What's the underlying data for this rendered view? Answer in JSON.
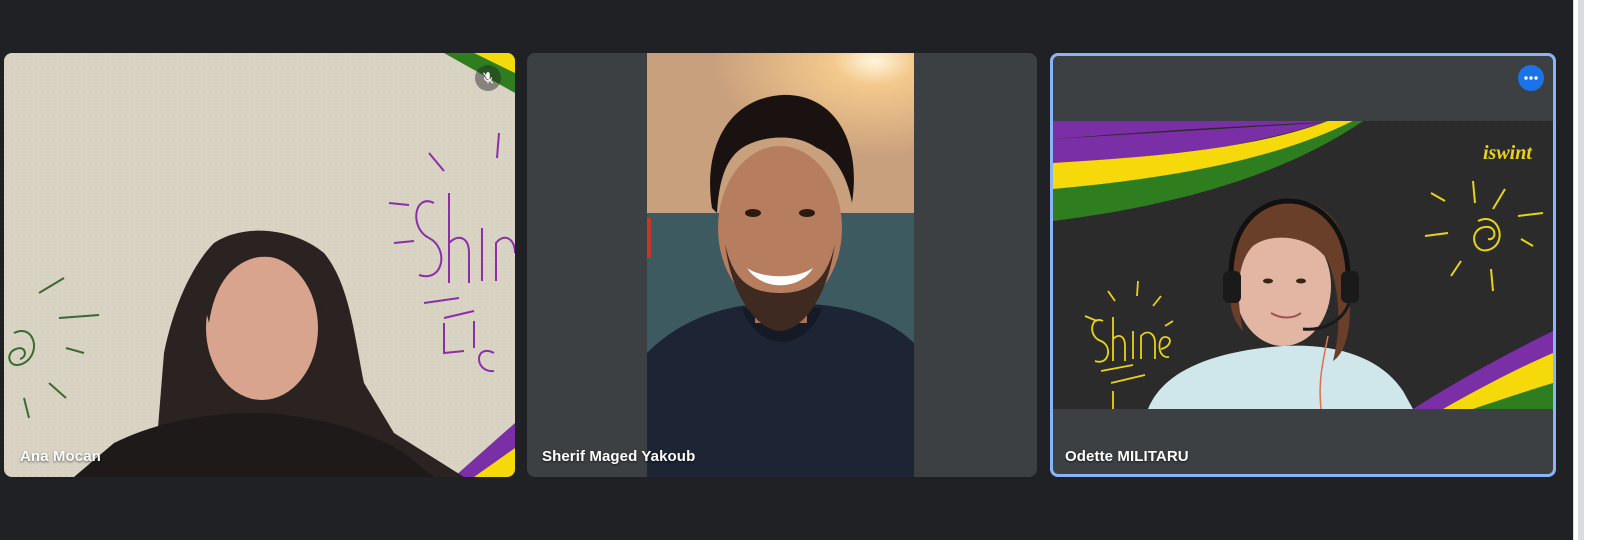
{
  "participants": [
    {
      "name": "Ana Mocan",
      "muted": true,
      "backdrop": "Shine your own LIGHT"
    },
    {
      "name": "Sherif Maged Yakoub",
      "muted": false
    },
    {
      "name": "Odette MILITARU",
      "muted": false,
      "backdrop": "Shine your own LIGHT",
      "backdrop_logo": "iswint",
      "highlighted": true
    }
  ],
  "colors": {
    "background": "#202124",
    "tile_background": "#3c4043",
    "active_border": "#8ab4f8",
    "more_button": "#1a73e8",
    "stripe_purple": "#7b2fa6",
    "stripe_yellow": "#f5d90a",
    "stripe_green": "#2e7d1f",
    "sketch_yellow": "#e8d31a"
  },
  "icons": {
    "mute": "mic-off-icon",
    "more": "more-options-icon"
  }
}
